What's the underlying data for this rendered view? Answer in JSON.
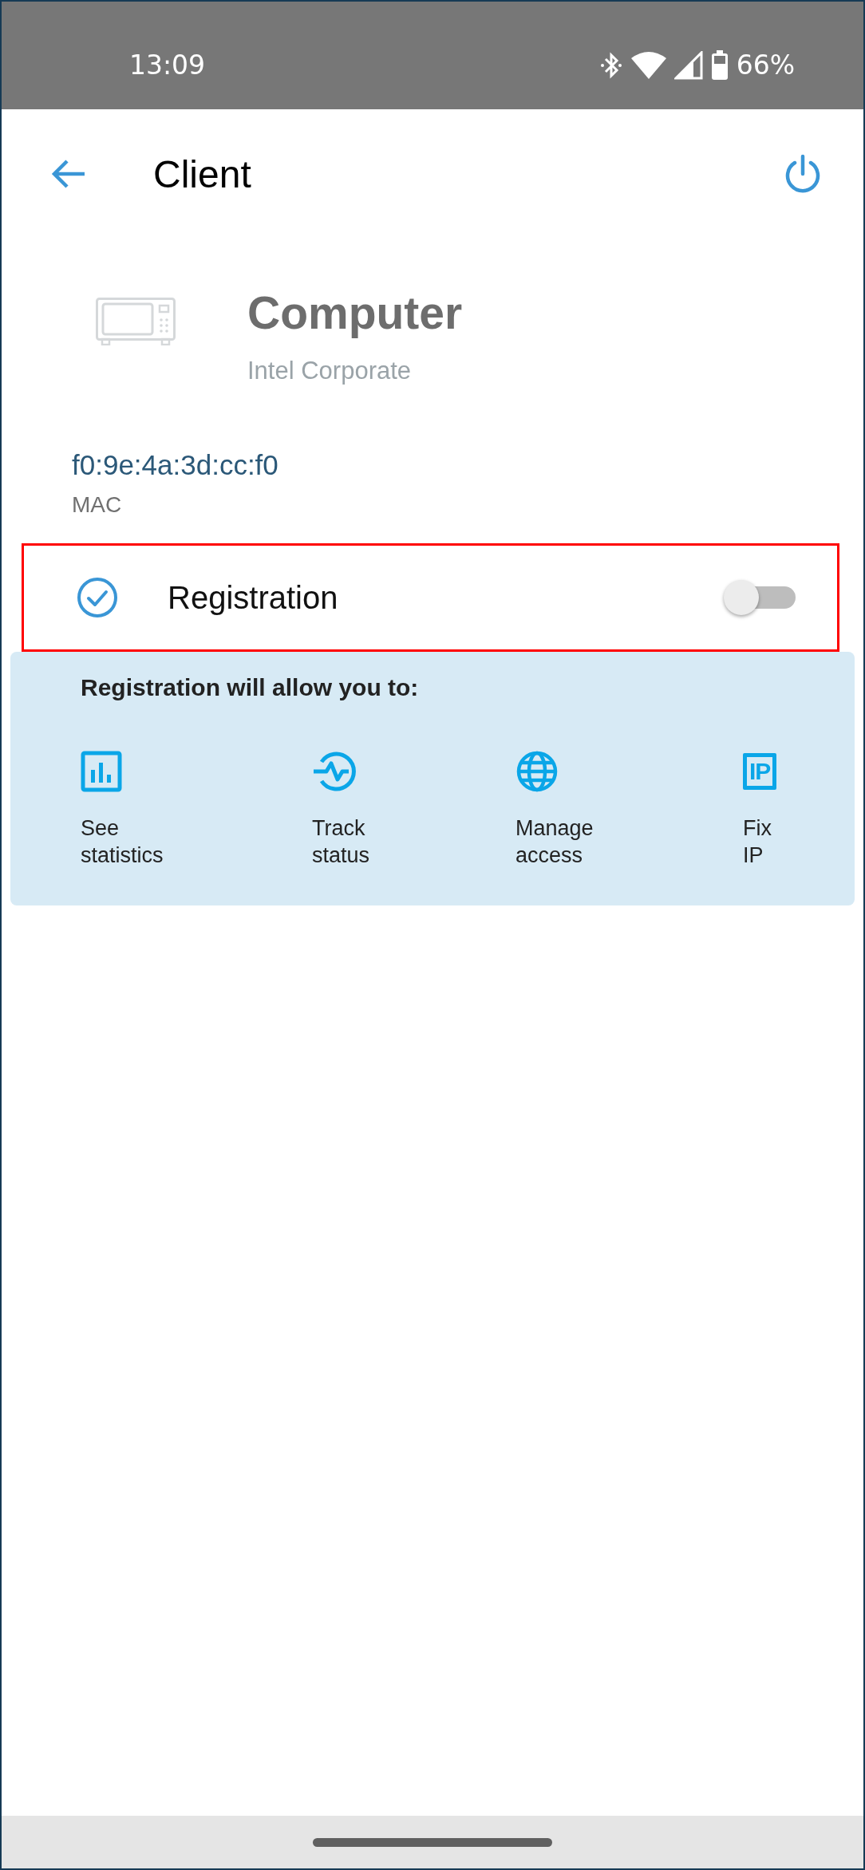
{
  "status_bar": {
    "time": "13:09",
    "battery": "66%"
  },
  "header": {
    "title": "Client"
  },
  "device": {
    "name": "Computer",
    "vendor": "Intel Corporate",
    "mac": "f0:9e:4a:3d:cc:f0",
    "mac_label": "MAC"
  },
  "registration": {
    "label": "Registration",
    "on": false,
    "highlighted": true
  },
  "benefits": {
    "title": "Registration will allow you to:",
    "items": [
      {
        "kind": "chart",
        "label": "See statistics"
      },
      {
        "kind": "pulse",
        "label": "Track status"
      },
      {
        "kind": "globe",
        "label": "Manage access"
      },
      {
        "kind": "ip",
        "label": "Fix IP",
        "icon_text": "IP"
      }
    ]
  }
}
